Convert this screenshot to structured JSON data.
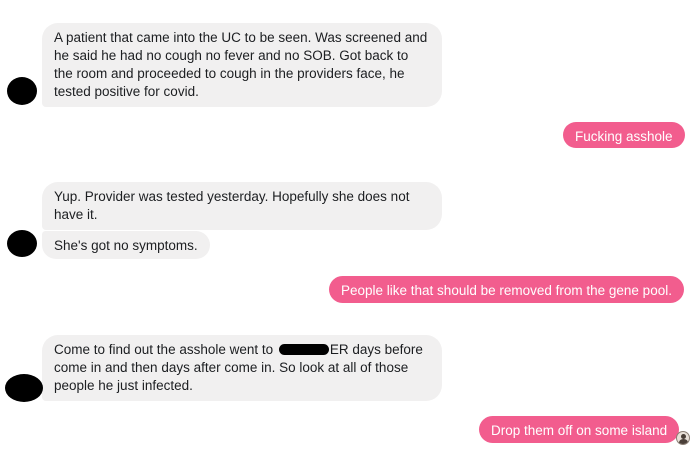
{
  "messages": {
    "m1": "A patient that came into the UC to be seen. Was screened and he said he had no cough no fever and no SOB. Got back to the room and proceeded to cough in the providers face, he tested positive for covid.",
    "m2": "Fucking asshole",
    "m3": "Yup. Provider was tested yesterday. Hopefully she does not have it.",
    "m4": "She's got no symptoms.",
    "m5": "People like that should be removed from the gene pool.",
    "m6_before": "Come to find out the asshole went to ",
    "m6_after": "ER days before come in and then days after come in. So look at all of those people he just infected.",
    "m7": "Drop them off on some island"
  },
  "colors": {
    "incoming_bubble": "#f1f0f0",
    "outgoing_bubble": "#f25d8e",
    "outgoing_text": "#ffffff",
    "avatar_redaction": "#000000"
  },
  "icons": {
    "avatar": "redacted-avatar-icon",
    "read_receipt": "read-receipt-avatar-icon"
  }
}
